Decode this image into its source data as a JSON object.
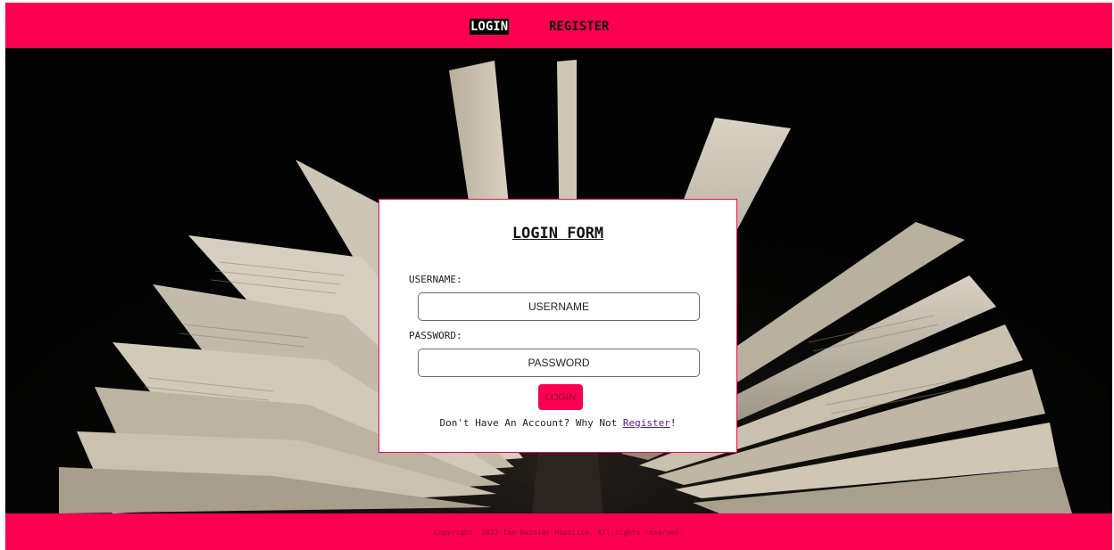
{
  "nav": {
    "login_label": "LOGIN",
    "register_label": "REGISTER"
  },
  "hero": {
    "image": "open-book-photo"
  },
  "form": {
    "title": "LOGIN FORM",
    "username_label": "USERNAME:",
    "username_placeholder": "USERNAME",
    "password_label": "PASSWORD:",
    "password_placeholder": "PASSWORD",
    "login_button": "LOGIN",
    "register_prompt": "Don't Have An Account? Why Not ",
    "register_link": "Register",
    "register_suffix": "!"
  },
  "footer": {
    "copyright": "Copyright. 2022 Ian Rainier Hipolito. All rights reserved."
  },
  "colors": {
    "accent": "#fb0050",
    "background": "#030303",
    "card": "#ffffff"
  }
}
